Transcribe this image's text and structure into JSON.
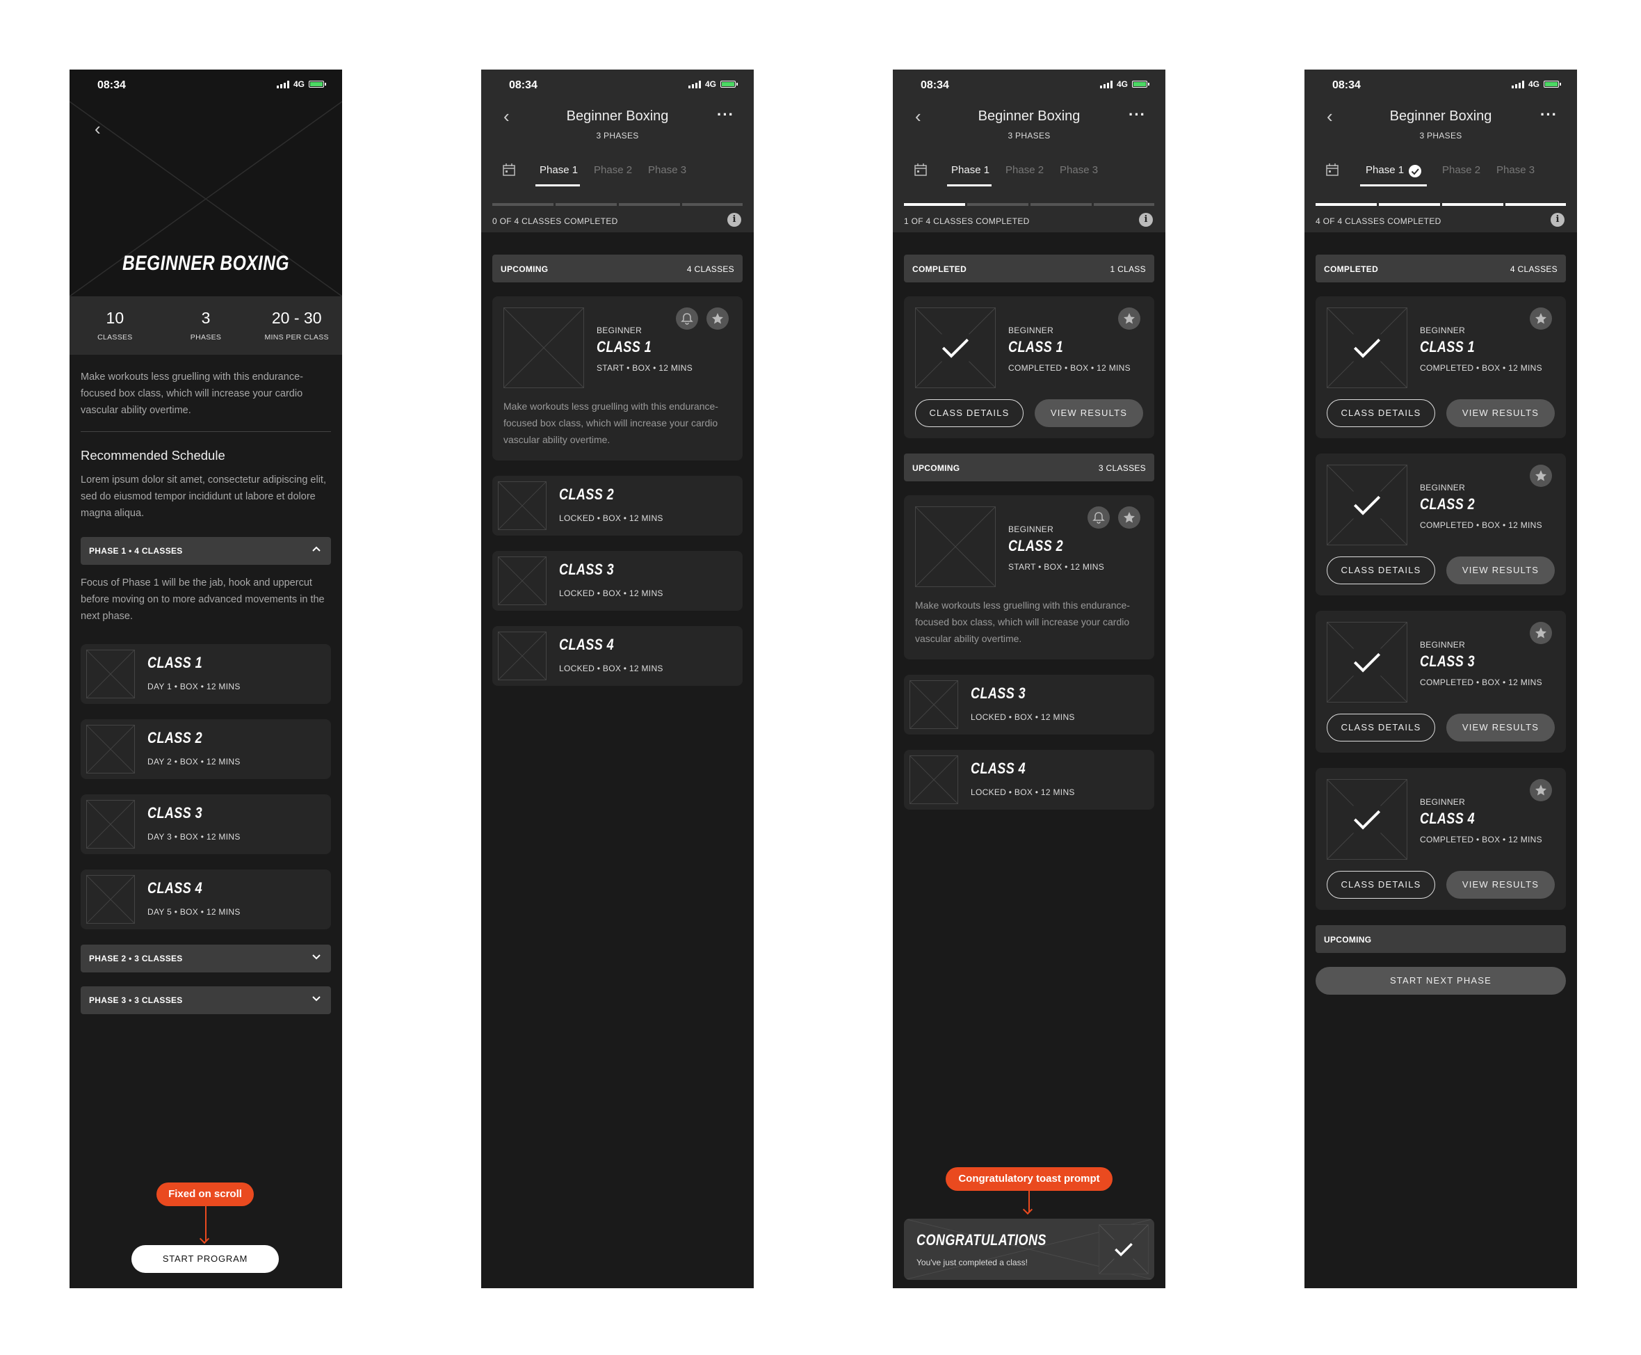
{
  "status": {
    "time": "08:34",
    "network": "4G"
  },
  "s1": {
    "title": "BEGINNER BOXING",
    "stats": [
      {
        "value": "10",
        "label": "CLASSES"
      },
      {
        "value": "3",
        "label": "PHASES"
      },
      {
        "value": "20 - 30",
        "label": "MINS PER CLASS"
      }
    ],
    "intro": "Make workouts less gruelling with this endurance-focused box class, which will increase your cardio vascular ability overtime.",
    "schedule_heading": "Recommended Schedule",
    "schedule_text": "Lorem ipsum dolor sit amet, consectetur adipiscing elit, sed do eiusmod tempor incididunt ut labore et dolore magna aliqua.",
    "phase1": "PHASE 1 • 4 CLASSES",
    "phase1_text": "Focus of Phase 1 will be the jab, hook and uppercut before moving on to more advanced movements in the next phase.",
    "classes": [
      {
        "title": "CLASS 1",
        "meta": "DAY 1 • BOX • 12 MINS"
      },
      {
        "title": "CLASS 2",
        "meta": "DAY 2 • BOX • 12 MINS"
      },
      {
        "title": "CLASS 3",
        "meta": "DAY 3 • BOX • 12 MINS"
      },
      {
        "title": "CLASS 4",
        "meta": "DAY 5 • BOX • 12 MINS"
      }
    ],
    "phase2": "PHASE 2 • 3 CLASSES",
    "phase3": "PHASE 3 • 3 CLASSES",
    "annotation": "Fixed on scroll",
    "cta": "START PROGRAM"
  },
  "nav": {
    "title": "Beginner Boxing",
    "subtitle": "3 PHASES",
    "tabs": [
      "Phase 1",
      "Phase 2",
      "Phase 3"
    ]
  },
  "labels": {
    "beginner": "BEGINNER",
    "completed": "COMPLETED",
    "upcoming": "UPCOMING",
    "class_details": "CLASS DETAILS",
    "view_results": "VIEW RESULTS",
    "desc": "Make workouts less gruelling with this endurance-focused box class, which will increase your cardio vascular ability overtime."
  },
  "s2": {
    "progress": "0 OF 4 CLASSES COMPLETED",
    "progress_value": 0,
    "upcoming_count": "4 CLASSES",
    "featured": {
      "title": "CLASS 1",
      "meta": "START • BOX • 12 MINS"
    },
    "locked": [
      {
        "title": "CLASS 2",
        "meta": "LOCKED • BOX • 12 MINS"
      },
      {
        "title": "CLASS 3",
        "meta": "LOCKED • BOX • 12 MINS"
      },
      {
        "title": "CLASS 4",
        "meta": "LOCKED • BOX • 12 MINS"
      }
    ]
  },
  "s3": {
    "progress": "1 OF 4 CLASSES COMPLETED",
    "progress_value": 0.25,
    "completed_count": "1 CLASS",
    "done": {
      "title": "CLASS 1",
      "meta": "COMPLETED • BOX • 12 MINS"
    },
    "upcoming_count": "3 CLASSES",
    "featured": {
      "title": "CLASS 2",
      "meta": "START • BOX • 12 MINS"
    },
    "locked": [
      {
        "title": "CLASS 3",
        "meta": "LOCKED • BOX • 12 MINS"
      },
      {
        "title": "CLASS 4",
        "meta": "LOCKED • BOX • 12 MINS"
      }
    ],
    "annotation": "Congratulatory toast prompt",
    "toast_title": "CONGRATULATIONS",
    "toast_text": "You've just completed a class!"
  },
  "s4": {
    "progress": "4 OF 4 CLASSES COMPLETED",
    "progress_value": 1,
    "completed_count": "4 CLASSES",
    "done": [
      {
        "title": "CLASS 1",
        "meta": "COMPLETED • BOX • 12 MINS"
      },
      {
        "title": "CLASS 2",
        "meta": "COMPLETED • BOX • 12 MINS"
      },
      {
        "title": "CLASS 3",
        "meta": "COMPLETED • BOX • 12 MINS"
      },
      {
        "title": "CLASS 4",
        "meta": "COMPLETED • BOX • 12 MINS"
      }
    ],
    "next_phase": "START NEXT PHASE"
  },
  "colors": {
    "background": "#1a1a1a",
    "surface": "#2c2c2c",
    "card": "#262626",
    "accent": "#ea4a1f",
    "battery": "#4cd964"
  }
}
